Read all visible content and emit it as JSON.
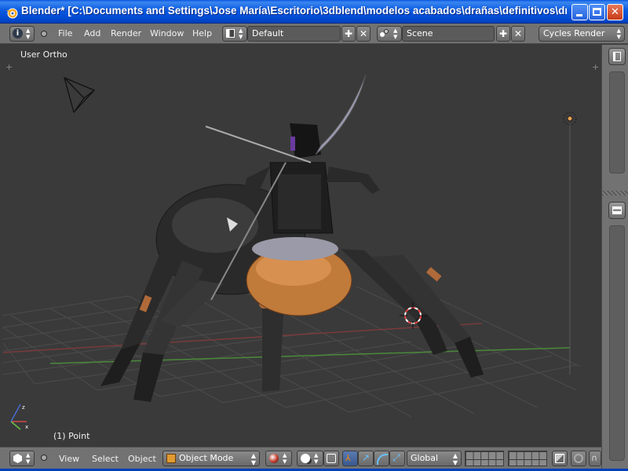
{
  "window": {
    "title": "Blender* [C:\\Documents and Settings\\Jose María\\Escritorio\\3dblend\\modelos acabados\\drañas\\definitivos\\dra...",
    "buttons": [
      "minimize",
      "maximize",
      "close"
    ]
  },
  "header": {
    "menus": [
      "File",
      "Add",
      "Render",
      "Window",
      "Help"
    ],
    "screen_layout": "Default",
    "scene": "Scene",
    "render_engine": "Cycles Render"
  },
  "viewport": {
    "view_label": "User Ortho",
    "object_label": "(1) Point",
    "background_color": "#3a3a3a",
    "grid_color": "#4a4a4a"
  },
  "footer": {
    "menus": [
      "View",
      "Select",
      "Object"
    ],
    "mode": "Object Mode",
    "orientation": "Global"
  },
  "colors": {
    "titlebar": "#0a5ae0",
    "header": "#727272",
    "axis_x": "#d04a4a",
    "axis_y": "#6ac04a",
    "axis_z": "#4a6ad0"
  }
}
